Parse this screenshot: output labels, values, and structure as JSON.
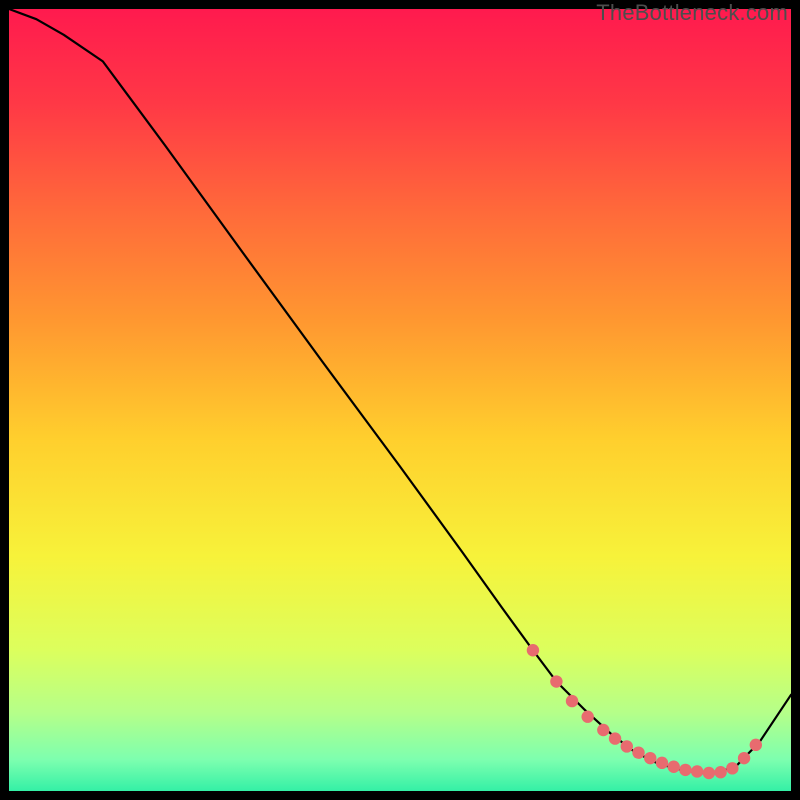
{
  "watermark": "TheBottleneck.com",
  "colors": {
    "frame": "#000000",
    "curve": "#000000",
    "dot_fill": "#e86b6f",
    "dot_stroke": "#c64a52"
  },
  "chart_data": {
    "type": "line",
    "title": "",
    "xlabel": "",
    "ylabel": "",
    "xlim": [
      0,
      100
    ],
    "ylim": [
      0,
      100
    ],
    "grid": false,
    "legend": false,
    "background_gradient": [
      {
        "stop": 0.0,
        "color": "#ff1a4e"
      },
      {
        "stop": 0.12,
        "color": "#ff3846"
      },
      {
        "stop": 0.26,
        "color": "#ff6a3a"
      },
      {
        "stop": 0.4,
        "color": "#ff9830"
      },
      {
        "stop": 0.55,
        "color": "#ffcf2d"
      },
      {
        "stop": 0.7,
        "color": "#f7f23a"
      },
      {
        "stop": 0.82,
        "color": "#dcff5d"
      },
      {
        "stop": 0.9,
        "color": "#b5ff89"
      },
      {
        "stop": 0.96,
        "color": "#7dffaf"
      },
      {
        "stop": 1.0,
        "color": "#34f0a6"
      }
    ],
    "series": [
      {
        "name": "curve",
        "x": [
          0,
          3.5,
          7,
          12,
          20,
          30,
          40,
          50,
          58,
          63,
          67,
          70,
          73.5,
          77,
          80,
          83,
          86,
          88.5,
          90.5,
          93,
          96,
          100
        ],
        "y": [
          100,
          98.7,
          96.7,
          93.3,
          82.5,
          68.7,
          55,
          41.5,
          30.5,
          23.5,
          18,
          14,
          10.5,
          7.3,
          5,
          3.5,
          2.7,
          2.3,
          2.3,
          3.2,
          6.3,
          12.3
        ]
      }
    ],
    "highlight_dots": {
      "name": "min-region",
      "x": [
        67,
        70,
        72,
        74,
        76,
        77.5,
        79,
        80.5,
        82,
        83.5,
        85,
        86.5,
        88,
        89.5,
        91,
        92.5,
        94,
        95.5
      ],
      "y": [
        18,
        14,
        11.5,
        9.5,
        7.8,
        6.7,
        5.7,
        4.9,
        4.2,
        3.6,
        3.1,
        2.7,
        2.5,
        2.3,
        2.4,
        2.9,
        4.2,
        5.9
      ]
    }
  }
}
